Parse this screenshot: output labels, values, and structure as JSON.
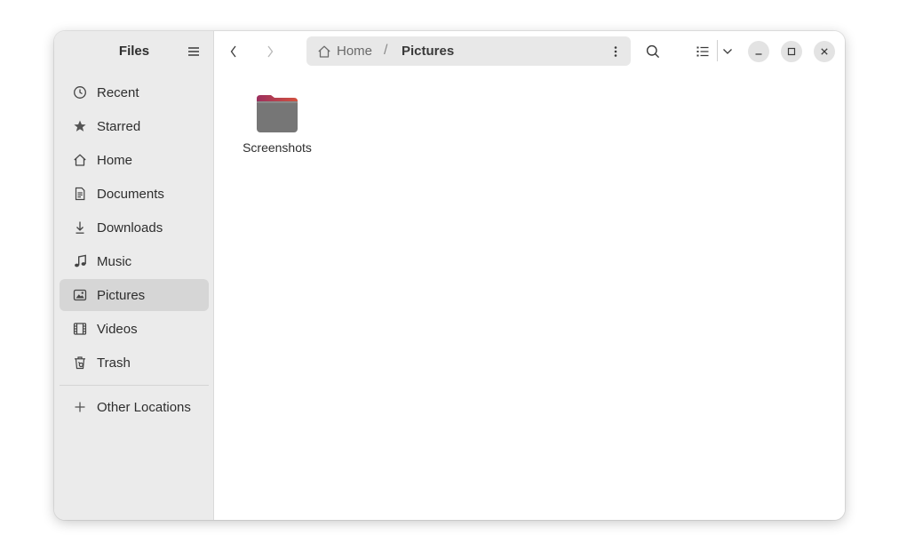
{
  "sidebar": {
    "title": "Files",
    "items": [
      {
        "label": "Recent",
        "icon": "clock-icon"
      },
      {
        "label": "Starred",
        "icon": "star-icon"
      },
      {
        "label": "Home",
        "icon": "home-icon"
      },
      {
        "label": "Documents",
        "icon": "document-icon"
      },
      {
        "label": "Downloads",
        "icon": "download-icon"
      },
      {
        "label": "Music",
        "icon": "music-icon"
      },
      {
        "label": "Pictures",
        "icon": "image-icon",
        "active": true
      },
      {
        "label": "Videos",
        "icon": "film-icon"
      },
      {
        "label": "Trash",
        "icon": "trash-icon"
      }
    ],
    "other_locations": {
      "label": "Other Locations",
      "icon": "plus-icon"
    }
  },
  "pathbar": {
    "home_label": "Home",
    "separator": "/",
    "current": "Pictures"
  },
  "files": [
    {
      "name": "Screenshots",
      "type": "folder",
      "color": "#7a7a7a",
      "accent": "#a53a63"
    }
  ],
  "colors": {
    "sidebar_bg": "#ebebeb",
    "active_item_bg": "#d6d6d6",
    "pathbar_bg": "#e8e8e8",
    "folder_body": "#7a7a7a",
    "folder_tab": "#b53b6b"
  }
}
